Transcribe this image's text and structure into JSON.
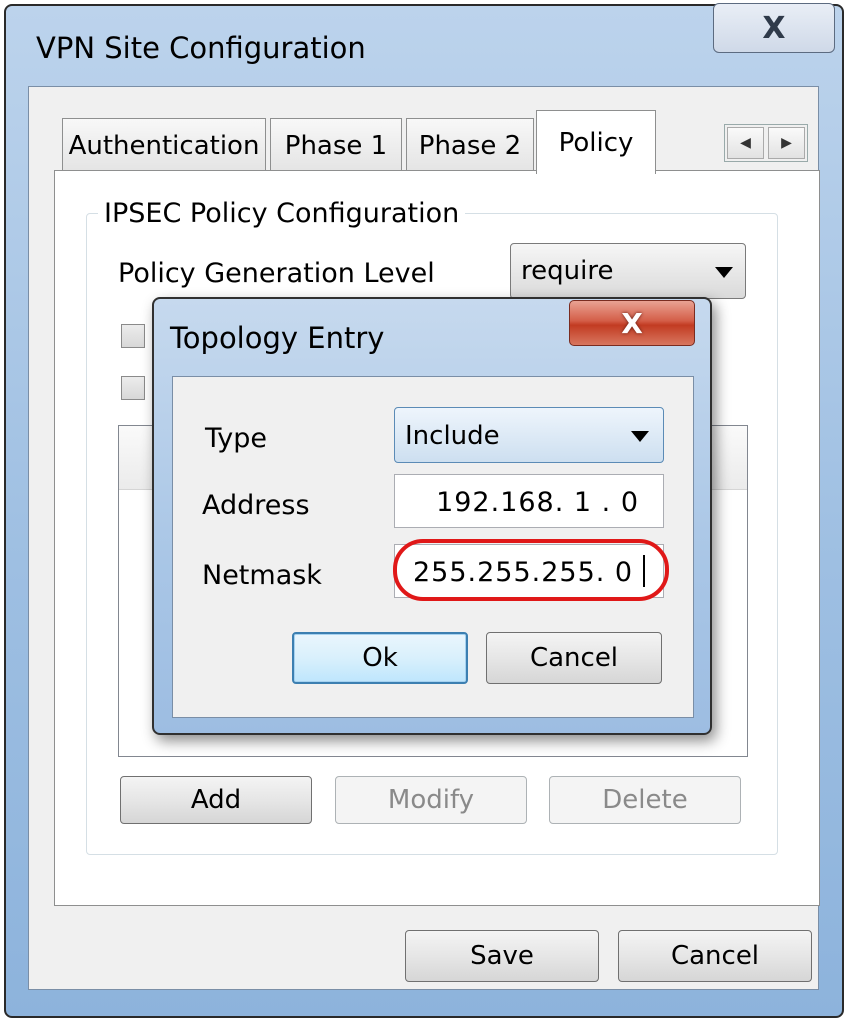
{
  "outer_window": {
    "title": "VPN Site Configuration",
    "close_glyph": "X",
    "tabs": [
      "Authentication",
      "Phase 1",
      "Phase 2",
      "Policy"
    ],
    "active_tab": "Policy",
    "tab_scroll_left": "◀",
    "tab_scroll_right": "▶",
    "group_title": "IPSEC Policy Configuration",
    "policy_generation_label": "Policy Generation Level",
    "policy_generation_value": "require",
    "list_buttons": {
      "add": "Add",
      "modify": "Modify",
      "delete": "Delete"
    },
    "footer_buttons": {
      "save": "Save",
      "cancel": "Cancel"
    }
  },
  "topology_dialog": {
    "title": "Topology Entry",
    "close_glyph": "X",
    "type_label": "Type",
    "type_value": "Include",
    "address_label": "Address",
    "address_value": "192.168. 1 . 0",
    "netmask_label": "Netmask",
    "netmask_value": "255.255.255. 0",
    "ok_label": "Ok",
    "cancel_label": "Cancel"
  },
  "colors": {
    "highlight_ring": "#e01818",
    "close_button_red": "#c23b22",
    "window_frame_blue": "#9ebfe2"
  }
}
